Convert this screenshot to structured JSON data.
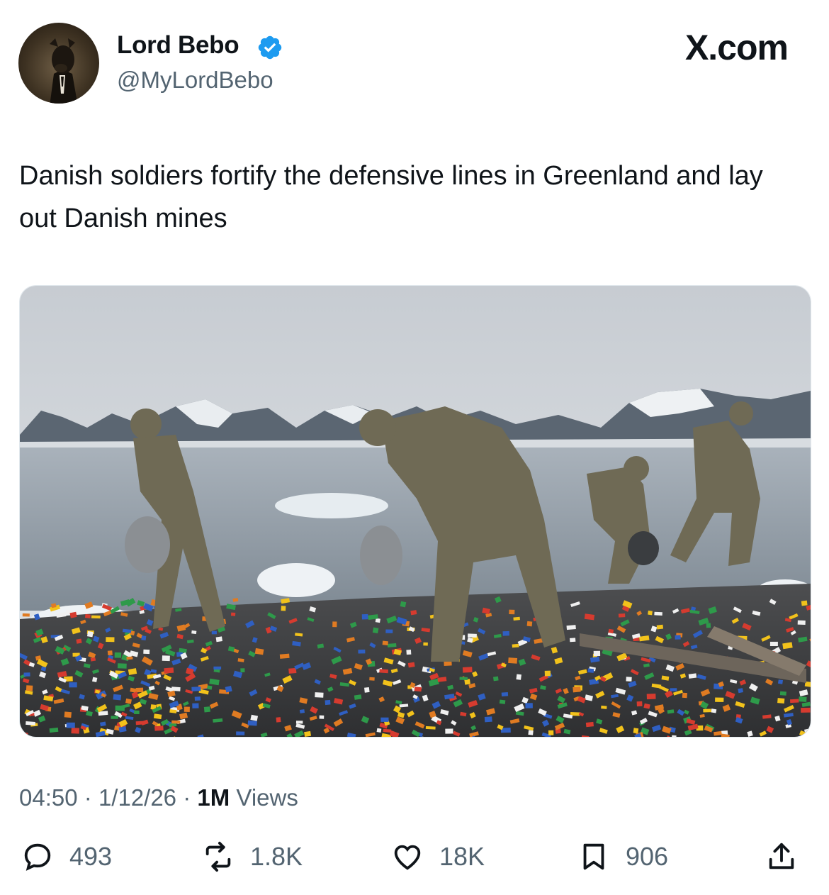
{
  "header": {
    "display_name": "Lord Bebo",
    "handle": "@MyLordBebo",
    "source": "X.com",
    "verified_color": "#1d9bf0"
  },
  "tweet": {
    "text": "Danish soldiers fortify the defensive lines in Greenland and lay out Danish mines",
    "time": "04:50",
    "date": "1/12/26",
    "views_count": "1M",
    "views_label": "Views",
    "separator": "·"
  },
  "actions": {
    "reply": {
      "icon": "reply-icon",
      "count": "493"
    },
    "retweet": {
      "icon": "retweet-icon",
      "count": "1.8K"
    },
    "like": {
      "icon": "heart-icon",
      "count": "18K"
    },
    "bookmark": {
      "icon": "bookmark-icon",
      "count": "906"
    },
    "share": {
      "icon": "share-icon"
    }
  },
  "colors": {
    "text_primary": "#0f1419",
    "text_secondary": "#536471",
    "accent": "#1d9bf0"
  }
}
